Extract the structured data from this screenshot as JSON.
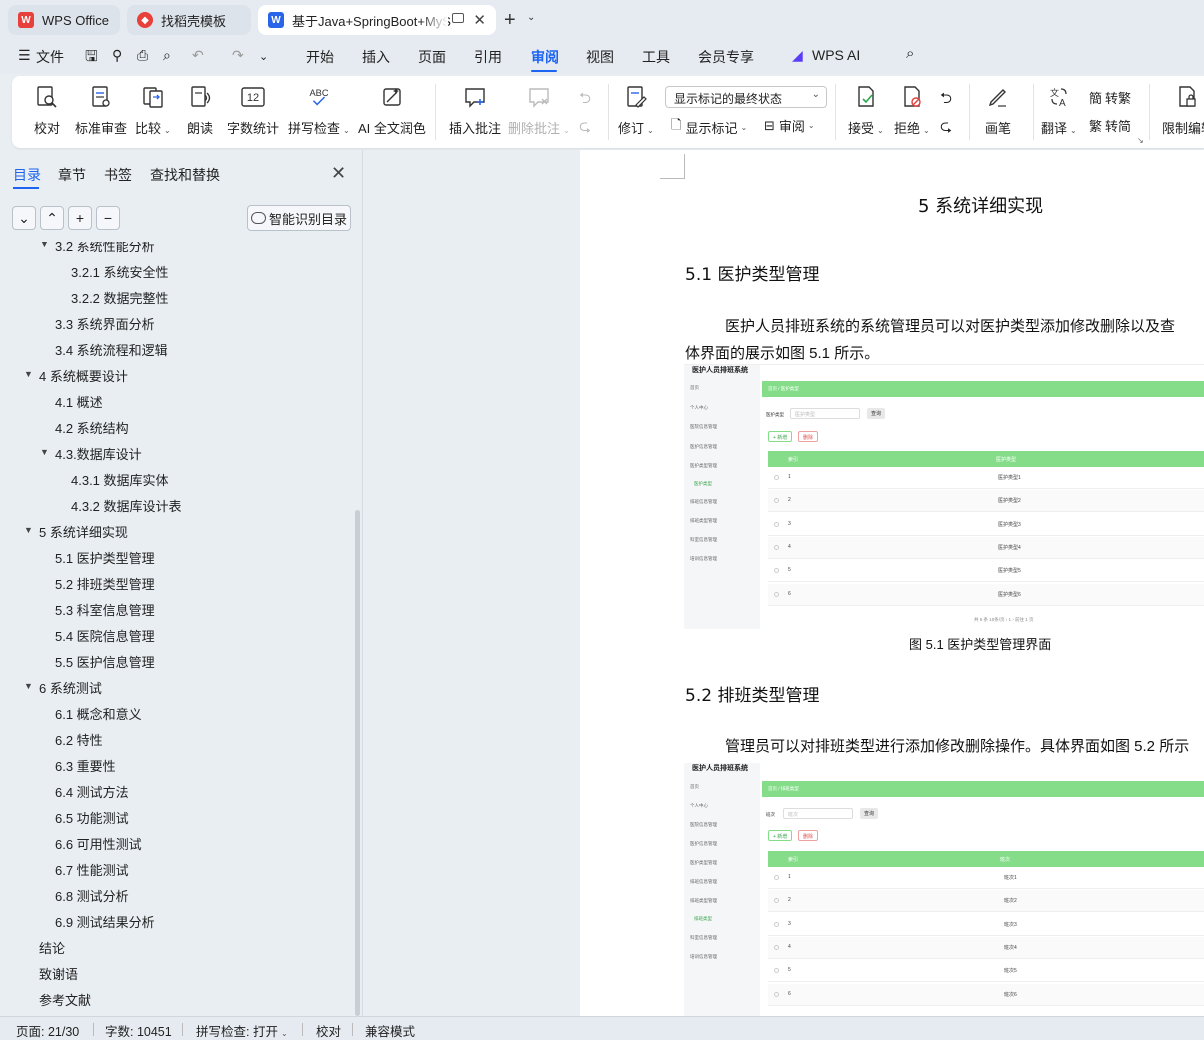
{
  "tabs": {
    "wps": "WPS Office",
    "template": "找稻壳模板",
    "doc": "基于Java+SpringBoot+MyS"
  },
  "menu": [
    "文件",
    "开始",
    "插入",
    "页面",
    "引用",
    "审阅",
    "视图",
    "工具",
    "会员专享",
    "WPS AI"
  ],
  "menu_active": "审阅",
  "ribbon": {
    "proof": "校对",
    "standard_review": "标准审查",
    "compare": "比较",
    "read_aloud": "朗读",
    "word_count": "字数统计",
    "spell_check": "拼写检查",
    "ai_polish": "AI 全文润色",
    "insert_comment": "插入批注",
    "delete_comment": "删除批注",
    "track_changes": "修订",
    "markup_mode": "显示标记的最终状态",
    "show_markup": "显示标记",
    "review": "审阅",
    "accept": "接受",
    "reject": "拒绝",
    "pen": "画笔",
    "translate": "翻译",
    "to_traditional": "转繁",
    "to_simplified": "转简",
    "restrict_edit": "限制编辑",
    "icon_word_count_text": "12",
    "icon_spell_text": "ABC"
  },
  "sidebar": {
    "tabs": [
      "目录",
      "章节",
      "书签",
      "查找和替换"
    ],
    "smart_toc": "智能识别目录",
    "toc": [
      {
        "text": "3.2 系统性能分析",
        "level": 2,
        "arrow": true
      },
      {
        "text": "3.2.1  系统安全性",
        "level": 3
      },
      {
        "text": "3.2.2  数据完整性",
        "level": 3
      },
      {
        "text": "3.3 系统界面分析",
        "level": 2
      },
      {
        "text": "3.4 系统流程和逻辑",
        "level": 2
      },
      {
        "text": "4 系统概要设计",
        "level": 1,
        "arrow": true
      },
      {
        "text": "4.1 概述",
        "level": 2
      },
      {
        "text": "4.2 系统结构",
        "level": 2
      },
      {
        "text": "4.3.数据库设计",
        "level": 2,
        "arrow": true
      },
      {
        "text": "4.3.1 数据库实体",
        "level": 3
      },
      {
        "text": "4.3.2 数据库设计表",
        "level": 3
      },
      {
        "text": "5 系统详细实现",
        "level": 1,
        "arrow": true
      },
      {
        "text": "5.1  医护类型管理",
        "level": 2
      },
      {
        "text": "5.2  排班类型管理",
        "level": 2
      },
      {
        "text": "5.3  科室信息管理",
        "level": 2
      },
      {
        "text": "5.4  医院信息管理",
        "level": 2
      },
      {
        "text": "5.5  医护信息管理",
        "level": 2
      },
      {
        "text": "6 系统测试",
        "level": 1,
        "arrow": true
      },
      {
        "text": "6.1 概念和意义",
        "level": 2
      },
      {
        "text": "6.2 特性",
        "level": 2
      },
      {
        "text": "6.3 重要性",
        "level": 2
      },
      {
        "text": "6.4 测试方法",
        "level": 2
      },
      {
        "text": "6.5  功能测试",
        "level": 2
      },
      {
        "text": "6.6 可用性测试",
        "level": 2
      },
      {
        "text": "6.7 性能测试",
        "level": 2
      },
      {
        "text": "6.8 测试分析",
        "level": 2
      },
      {
        "text": "6.9 测试结果分析",
        "level": 2
      },
      {
        "text": "结论",
        "level": 1
      },
      {
        "text": "致谢语",
        "level": 1
      },
      {
        "text": "参考文献",
        "level": 1
      }
    ]
  },
  "document": {
    "chapter_title": "5 系统详细实现",
    "sec1_title": "5.1  医护类型管理",
    "sec1_para_line1": "医护人员排班系统的系统管理员可以对医护类型添加修改删除以及查",
    "sec1_para_line2": "体界面的展示如图 5.1 所示。",
    "fig1_caption": "图 5.1  医护类型管理界面",
    "sec2_title": "5.2  排班类型管理",
    "sec2_para": "管理员可以对排班类型进行添加修改删除操作。具体界面如图 5.2 所示",
    "fig1": {
      "app_title": "医护人员排班系统",
      "nav": [
        "首页",
        "个人中心",
        "医院信息管理",
        "医护信息管理",
        "医护类型管理",
        "医护类型",
        "排班信息管理",
        "排班类型管理",
        "科室信息管理",
        "培训信息管理"
      ],
      "breadcrumb": "首页 / 医护类型",
      "filter_label": "医护类型",
      "filter_placeholder": "医护类型",
      "search_btn": "查询",
      "add_btn": "+ 新增",
      "delete_btn": "删除",
      "col_index": "索引",
      "col_type": "医护类型",
      "rows": [
        {
          "idx": "1",
          "val": "医护类型1"
        },
        {
          "idx": "2",
          "val": "医护类型2"
        },
        {
          "idx": "3",
          "val": "医护类型3"
        },
        {
          "idx": "4",
          "val": "医护类型4"
        },
        {
          "idx": "5",
          "val": "医护类型5"
        },
        {
          "idx": "6",
          "val": "医护类型6"
        }
      ],
      "pager": "共 6 条   10条/页   ‹  1  ›   前往  1  页"
    },
    "fig2": {
      "app_title": "医护人员排班系统",
      "nav": [
        "首页",
        "个人中心",
        "医院信息管理",
        "医护信息管理",
        "医护类型管理",
        "排班信息管理",
        "排班类型管理",
        "排班类型",
        "科室信息管理",
        "培训信息管理"
      ],
      "breadcrumb": "首页 / 排班类型",
      "filter_label": "班次",
      "filter_placeholder": "班次",
      "search_btn": "查询",
      "add_btn": "+ 新增",
      "delete_btn": "删除",
      "col_index": "索引",
      "col_type": "班次",
      "rows": [
        {
          "idx": "1",
          "val": "班次1"
        },
        {
          "idx": "2",
          "val": "班次2"
        },
        {
          "idx": "3",
          "val": "班次3"
        },
        {
          "idx": "4",
          "val": "班次4"
        },
        {
          "idx": "5",
          "val": "班次5"
        },
        {
          "idx": "6",
          "val": "班次6"
        }
      ]
    }
  },
  "status": {
    "page": "页面: 21/30",
    "words": "字数: 10451",
    "spell": "拼写检查: 打开",
    "proof": "校对",
    "compat": "兼容模式"
  },
  "colors": {
    "accent": "#1d64f2",
    "wps_red": "#e8403a",
    "table_green": "#85dd8a"
  }
}
